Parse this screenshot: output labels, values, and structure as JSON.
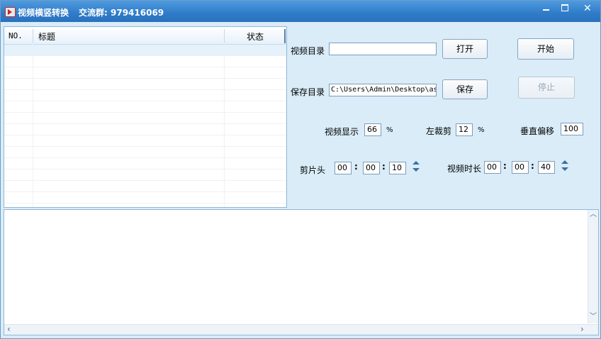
{
  "window": {
    "title": "视频横竖转换",
    "group_text": "交流群: 979416069",
    "min_icon": "minimize-icon",
    "max_icon": "maximize-icon",
    "close_icon": "close-icon"
  },
  "list": {
    "headers": {
      "no": "NO.",
      "title": "标题",
      "status": "状态"
    }
  },
  "controls": {
    "video_dir_label": "视频目录",
    "video_dir_value": "",
    "open_button": "打开",
    "start_button": "开始",
    "save_dir_label": "保存目录",
    "save_dir_value": "C:\\Users\\Admin\\Desktop\\as",
    "save_button": "保存",
    "stop_button": "停止",
    "display_label": "视频显示",
    "display_value": "66",
    "display_unit": "%",
    "left_crop_label": "左裁剪",
    "left_crop_value": "12",
    "left_crop_unit": "%",
    "vertical_offset_label": "垂直偏移",
    "vertical_offset_value": "100",
    "clip_head_label": "剪片头",
    "clip_head": [
      "00",
      "00",
      "10"
    ],
    "duration_label": "视频时长",
    "duration": [
      "00",
      "00",
      "40"
    ],
    "colon": ":"
  },
  "colors": {
    "titlebar": "#2f7bc8",
    "background": "#d9ecf8"
  }
}
